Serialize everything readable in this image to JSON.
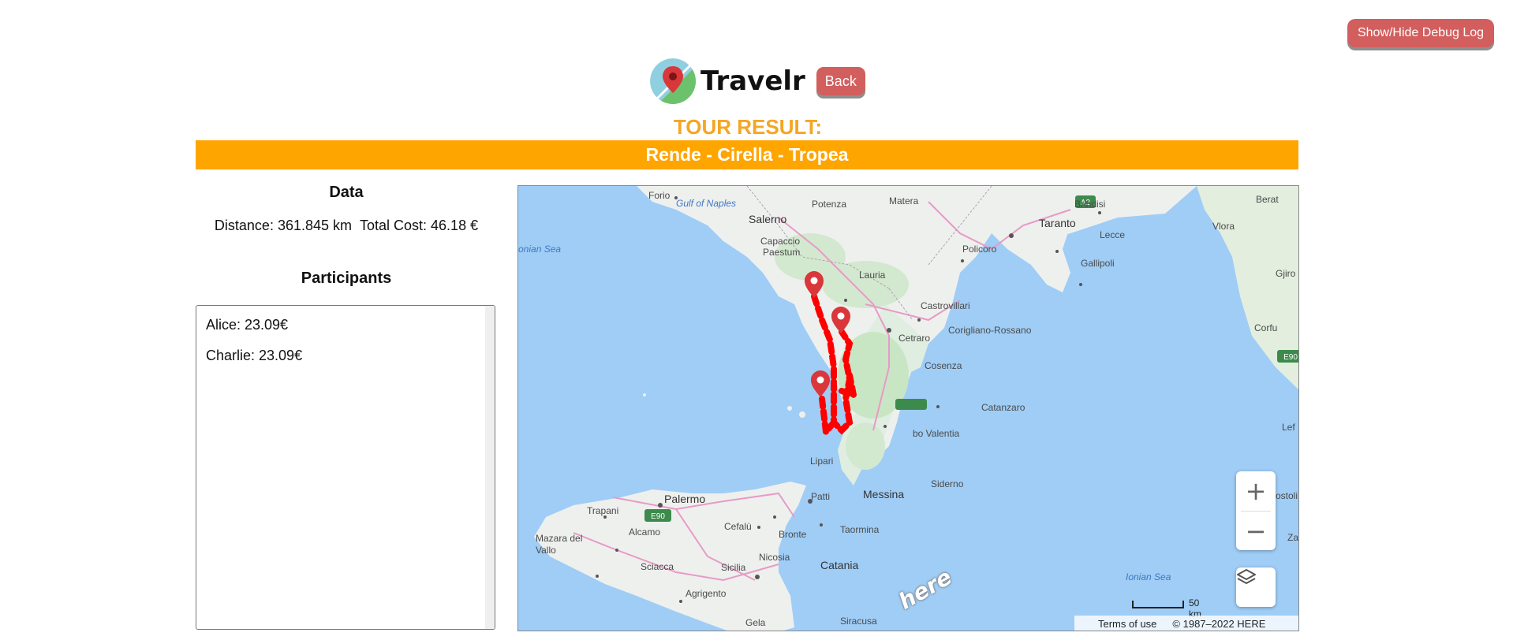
{
  "header": {
    "debug_button": "Show/Hide Debug Log",
    "app_name": "Travelr",
    "back_button": "Back"
  },
  "tour": {
    "heading": "TOUR RESULT:",
    "route": "Rende - Cirella - Tropea"
  },
  "data_panel": {
    "heading": "Data",
    "distance": "Distance: 361.845 km",
    "total_cost": "Total Cost: 46.18 €"
  },
  "participants": {
    "heading": "Participants",
    "items": [
      {
        "label": "Alice: 23.09€"
      },
      {
        "label": "Charlie: 23.09€"
      }
    ]
  },
  "map": {
    "labels": {
      "forio": "Forio",
      "gulf_of_naples": "Gulf of Naples",
      "potenza": "Potenza",
      "matera": "Matera",
      "brindisi": "Brindisi",
      "taranto": "Taranto",
      "lecce": "Lecce",
      "gallipoli": "Gallipoli",
      "salerno": "Salerno",
      "capaccio": "Capaccio",
      "paestum": "Paestum",
      "policoro": "Policoro",
      "lauria": "Lauria",
      "castrovillari": "Castrovillari",
      "corigliano": "Corigliano-Rossano",
      "cetraro": "Cetraro",
      "cosenza": "Cosenza",
      "catanzaro": "Catanzaro",
      "vibo": "bo Valentia",
      "lipari": "Lipari",
      "siderno": "Siderno",
      "messina": "Messina",
      "patti": "Patti",
      "palermo": "Palermo",
      "trapani": "Trapani",
      "alcamo": "Alcamo",
      "cefalu": "Cefalù",
      "bronte": "Bronte",
      "taormina": "Taormina",
      "mazara_1": "Mazara del",
      "mazara_2": "Vallo",
      "nicosia": "Nicosia",
      "sciacca": "Sciacca",
      "sicilia": "Sicilia",
      "catania": "Catania",
      "agrigento": "Agrigento",
      "gela": "Gela",
      "siracusa": "Siracusa",
      "ionian_sea_left": "onian Sea",
      "ionian_sea": "Ionian Sea",
      "berat": "Berat",
      "vlora": "Vlora",
      "gjiro": "Gjiro",
      "corfu": "Corfu",
      "lef": "Lef",
      "ostoli": "ostoli",
      "za": "Za",
      "shield_a2": "A2",
      "shield_e90": "E90"
    },
    "scale_label": "50 km",
    "terms": "Terms of use",
    "copyright": "© 1987–2022 HERE",
    "here_logo": "here",
    "zoom_in": "+",
    "zoom_out": "−"
  },
  "colors": {
    "accent_orange": "#ffa500",
    "title_orange": "#f5a623",
    "button_red": "#d35e5e",
    "route_red": "#ff0000",
    "sea_blue": "#9fcdf6"
  }
}
